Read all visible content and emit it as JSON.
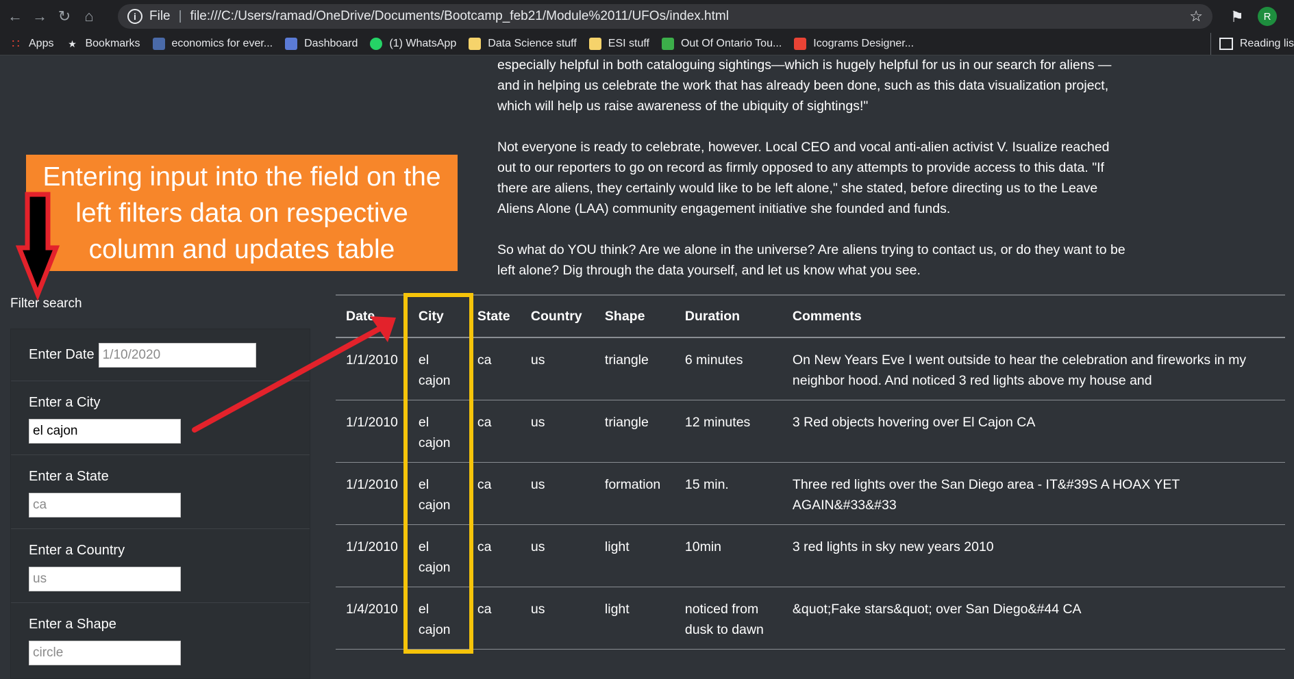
{
  "browser": {
    "file_label": "File",
    "url": "file:///C:/Users/ramad/OneDrive/Documents/Bootcamp_feb21/Module%2011/UFOs/index.html",
    "profile_initial": "R",
    "bookmarks": [
      {
        "label": "Apps",
        "icon": "apps-grid-icon",
        "color": "#ea4335"
      },
      {
        "label": "Bookmarks",
        "icon": "star-icon",
        "color": "#e8eaed"
      },
      {
        "label": "economics for ever...",
        "icon": "efe-favicon",
        "color": "#4a6aa8"
      },
      {
        "label": "Dashboard",
        "icon": "dashboard-favicon",
        "color": "#5b7bd6"
      },
      {
        "label": "(1) WhatsApp",
        "icon": "whatsapp-icon",
        "color": "#25d366"
      },
      {
        "label": "Data Science stuff",
        "icon": "folder-icon",
        "color": "#f6d36b"
      },
      {
        "label": "ESI stuff",
        "icon": "folder-icon",
        "color": "#f6d36b"
      },
      {
        "label": "Out Of Ontario Tou...",
        "icon": "leaf-favicon",
        "color": "#3cae4a"
      },
      {
        "label": "Icograms Designer...",
        "icon": "icograms-favicon",
        "color": "#e94335"
      }
    ],
    "reading_list": "Reading lis"
  },
  "article": {
    "paragraphs": [
      "especially helpful in both cataloguing sightings—which is hugely helpful for us in our search for aliens —and in helping us celebrate the work that has already been done, such as this data visualization project, which will help us raise awareness of the ubiquity of sightings!\"",
      "Not everyone is ready to celebrate, however. Local CEO and vocal anti-alien activist V. Isualize reached out to our reporters to go on record as firmly opposed to any attempts to provide access to this data. \"If there are aliens, they certainly would like to be left alone,\" she stated, before directing us to the Leave Aliens Alone (LAA) community engagement initiative she founded and funds.",
      "So what do YOU think? Are we alone in the universe? Are aliens trying to contact us, or do they want to be left alone? Dig through the data yourself, and let us know what you see."
    ]
  },
  "annotation": {
    "callout_text": "Entering input into the field on the left filters data on respective column and updates table",
    "callout_color": "#f7862a",
    "arrow_color": "#e3222b",
    "highlight_color": "#f6c40a"
  },
  "filter": {
    "title": "Filter search",
    "fields": [
      {
        "label": "Enter Date",
        "value": "",
        "placeholder": "1/10/2020"
      },
      {
        "label": "Enter a City",
        "value": "el cajon",
        "placeholder": ""
      },
      {
        "label": "Enter a State",
        "value": "",
        "placeholder": "ca"
      },
      {
        "label": "Enter a Country",
        "value": "",
        "placeholder": "us"
      },
      {
        "label": "Enter a Shape",
        "value": "",
        "placeholder": "circle"
      }
    ]
  },
  "table": {
    "headers": [
      "Date",
      "City",
      "State",
      "Country",
      "Shape",
      "Duration",
      "Comments"
    ],
    "rows": [
      [
        "1/1/2010",
        "el cajon",
        "ca",
        "us",
        "triangle",
        "6 minutes",
        "On New Years Eve I went outside to hear the celebration and fireworks in my neighbor hood. And noticed 3 red lights above my house and"
      ],
      [
        "1/1/2010",
        "el cajon",
        "ca",
        "us",
        "triangle",
        "12 minutes",
        "3 Red objects hovering over El Cajon CA"
      ],
      [
        "1/1/2010",
        "el cajon",
        "ca",
        "us",
        "formation",
        "15 min.",
        "Three red lights over the San Diego area - IT&#39S A HOAX YET AGAIN&#33&#33"
      ],
      [
        "1/1/2010",
        "el cajon",
        "ca",
        "us",
        "light",
        "10min",
        "3 red lights in sky new years 2010"
      ],
      [
        "1/4/2010",
        "el cajon",
        "ca",
        "us",
        "light",
        "noticed from dusk to dawn",
        "&quot;Fake stars&quot; over San Diego&#44 CA"
      ]
    ]
  }
}
